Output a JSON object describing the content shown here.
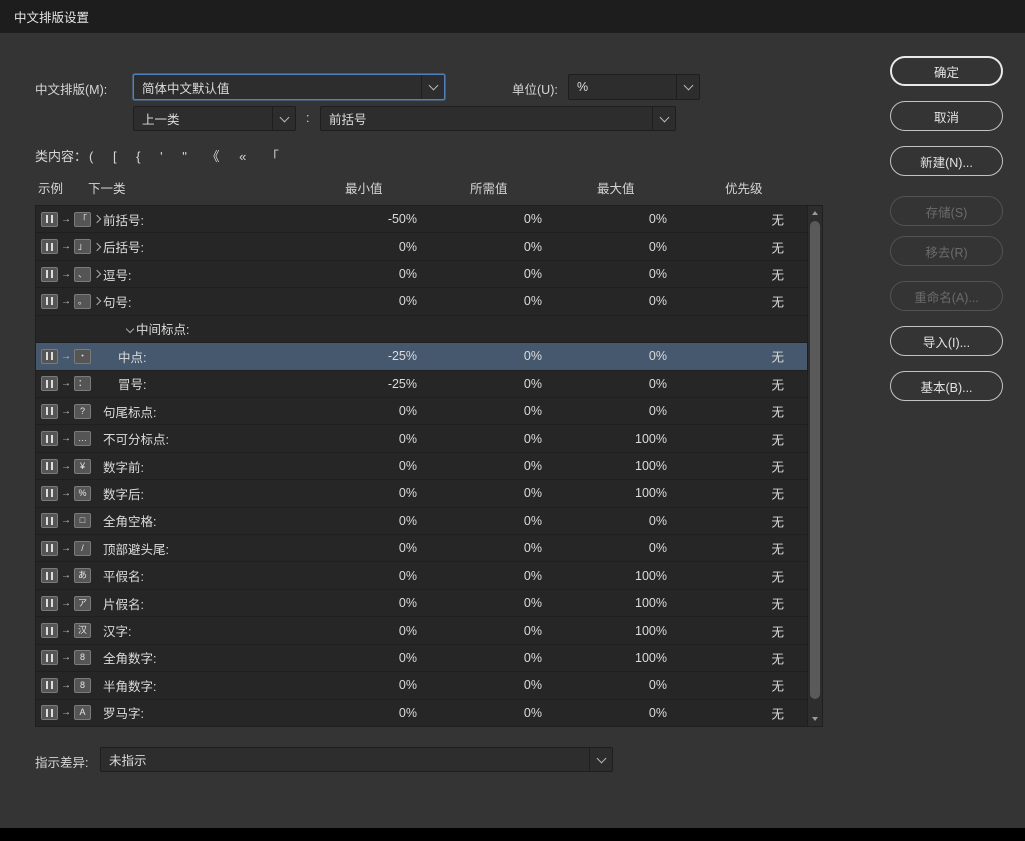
{
  "title_bar": {
    "title": "中文排版设置"
  },
  "toolbar": {
    "composition_label": "中文排版(M):",
    "composition_value": "简体中文默认值",
    "unit_label": "单位(U):",
    "unit_value": "%",
    "prev_class_value": "上一类",
    "colon": ":",
    "current_class_value": "前括号",
    "class_content_label": "类内容：",
    "class_content_chars": "(  [  {  '  \"  《  «  「"
  },
  "table": {
    "headers": {
      "sample": "示例",
      "next_class": "下一类",
      "min": "最小值",
      "desired": "所需值",
      "max": "最大值",
      "priority": "优先级"
    },
    "rows": [
      {
        "type": "expandable",
        "label": "前括号:",
        "icon": "「",
        "min": "-50%",
        "desired": "0%",
        "max": "0%",
        "priority": "无",
        "selected": false
      },
      {
        "type": "expandable",
        "label": "后括号:",
        "icon": "」",
        "min": "0%",
        "desired": "0%",
        "max": "0%",
        "priority": "无",
        "selected": false
      },
      {
        "type": "expandable",
        "label": "逗号:",
        "icon": "、",
        "min": "0%",
        "desired": "0%",
        "max": "0%",
        "priority": "无",
        "selected": false
      },
      {
        "type": "expandable",
        "label": "句号:",
        "icon": "。",
        "min": "0%",
        "desired": "0%",
        "max": "0%",
        "priority": "无",
        "selected": false
      },
      {
        "type": "group",
        "label": "中间标点:",
        "selected": false
      },
      {
        "type": "child",
        "label": "中点:",
        "icon": "・",
        "min": "-25%",
        "desired": "0%",
        "max": "0%",
        "priority": "无",
        "selected": true
      },
      {
        "type": "child",
        "label": "冒号:",
        "icon": "：",
        "min": "-25%",
        "desired": "0%",
        "max": "0%",
        "priority": "无",
        "selected": false
      },
      {
        "type": "plain",
        "label": "句尾标点:",
        "icon": "?",
        "min": "0%",
        "desired": "0%",
        "max": "0%",
        "priority": "无",
        "selected": false
      },
      {
        "type": "plain",
        "label": "不可分标点:",
        "icon": "…",
        "min": "0%",
        "desired": "0%",
        "max": "100%",
        "priority": "无",
        "selected": false
      },
      {
        "type": "plain",
        "label": "数字前:",
        "icon": "¥",
        "min": "0%",
        "desired": "0%",
        "max": "100%",
        "priority": "无",
        "selected": false
      },
      {
        "type": "plain",
        "label": "数字后:",
        "icon": "%",
        "min": "0%",
        "desired": "0%",
        "max": "100%",
        "priority": "无",
        "selected": false
      },
      {
        "type": "plain",
        "label": "全角空格:",
        "icon": "□",
        "min": "0%",
        "desired": "0%",
        "max": "0%",
        "priority": "无",
        "selected": false
      },
      {
        "type": "plain",
        "label": "顶部避头尾:",
        "icon": "/",
        "min": "0%",
        "desired": "0%",
        "max": "0%",
        "priority": "无",
        "selected": false
      },
      {
        "type": "plain",
        "label": "平假名:",
        "icon": "あ",
        "min": "0%",
        "desired": "0%",
        "max": "100%",
        "priority": "无",
        "selected": false
      },
      {
        "type": "plain",
        "label": "片假名:",
        "icon": "ア",
        "min": "0%",
        "desired": "0%",
        "max": "100%",
        "priority": "无",
        "selected": false
      },
      {
        "type": "plain",
        "label": "汉字:",
        "icon": "汉",
        "min": "0%",
        "desired": "0%",
        "max": "100%",
        "priority": "无",
        "selected": false
      },
      {
        "type": "plain",
        "label": "全角数字:",
        "icon": "8",
        "min": "0%",
        "desired": "0%",
        "max": "100%",
        "priority": "无",
        "selected": false
      },
      {
        "type": "plain",
        "label": "半角数字:",
        "icon": "8",
        "min": "0%",
        "desired": "0%",
        "max": "0%",
        "priority": "无",
        "selected": false
      },
      {
        "type": "plain",
        "label": "罗马字:",
        "icon": "A",
        "min": "0%",
        "desired": "0%",
        "max": "0%",
        "priority": "无",
        "selected": false
      }
    ]
  },
  "footer": {
    "indicate_label": "指示差异:",
    "indicate_value": "未指示"
  },
  "buttons": [
    {
      "label": "确定",
      "enabled": true,
      "emphasized": true
    },
    {
      "label": "取消",
      "enabled": true
    },
    {
      "label": "新建(N)...",
      "enabled": true
    },
    {
      "label": "存储(S)",
      "enabled": false
    },
    {
      "label": "移去(R)",
      "enabled": false
    },
    {
      "label": "重命名(A)...",
      "enabled": false
    },
    {
      "label": "导入(I)...",
      "enabled": true
    },
    {
      "label": "基本(B)...",
      "enabled": true
    }
  ],
  "colors": {
    "selected_row": "#45586d",
    "focus_border": "#4f81c0",
    "dialog_bg": "#343434",
    "table_bg": "#262626"
  }
}
